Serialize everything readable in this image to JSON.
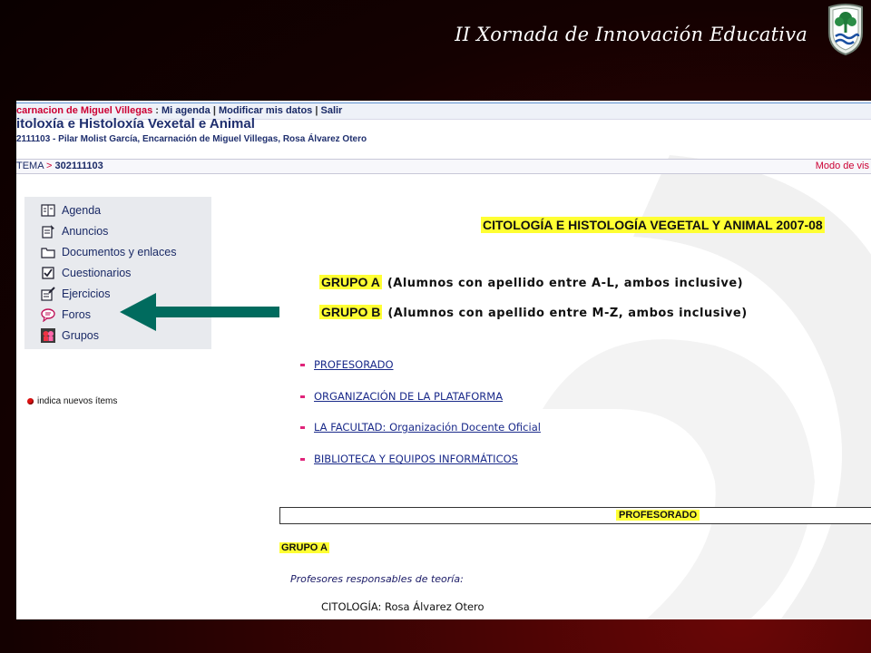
{
  "slide": {
    "title": "II Xornada de Innovación Educativa"
  },
  "topbar": {
    "user_name": "carnacion de Miguel Villegas",
    "links": [
      "Mi agenda",
      "Modificar mis datos",
      "Salir"
    ]
  },
  "course": {
    "title": "itoloxía e Histoloxía Vexetal e Animal",
    "professors": "2111103 - Pilar Molist García, Encarnación de Miguel Villegas, Rosa Álvarez Otero"
  },
  "breadcrumb": {
    "root": "TEMA",
    "separator": ">",
    "code": "302111103",
    "mode": "Modo de vis"
  },
  "sidebar": {
    "items": [
      {
        "label": "Agenda",
        "icon": "agenda-icon"
      },
      {
        "label": "Anuncios",
        "icon": "announcements-icon"
      },
      {
        "label": "Documentos y enlaces",
        "icon": "folder-icon"
      },
      {
        "label": "Cuestionarios",
        "icon": "checkbox-icon"
      },
      {
        "label": "Ejercicios",
        "icon": "exercise-icon"
      },
      {
        "label": "Foros",
        "icon": "forum-icon"
      },
      {
        "label": "Grupos",
        "icon": "groups-icon"
      }
    ],
    "legend": "indica nuevos ítems"
  },
  "content": {
    "heading": "CITOLOGÍA E HISTOLOGÍA VEGETAL Y ANIMAL 2007-08",
    "groups": [
      {
        "tag": "GRUPO A",
        "desc": "(Alumnos con apellido entre A-L, ambos inclusive)"
      },
      {
        "tag": "GRUPO B",
        "desc": "(Alumnos con apellido entre M-Z, ambos inclusive)"
      }
    ],
    "links": [
      "PROFESORADO",
      "ORGANIZACIÓN DE LA PLATAFORMA",
      "LA FACULTAD: Organización Docente Oficial",
      "BIBLIOTECA Y EQUIPOS INFORMÁTICOS"
    ],
    "section_label": "PROFESORADO",
    "section_group": "GRUPO A",
    "responsables": "Profesores responsables de teoría:",
    "citologia": "CITOLOGÍA: Rosa Álvarez Otero"
  },
  "colors": {
    "accent_yellow": "#ffff33",
    "link_blue": "#1a2a8a",
    "arrow_teal": "#006b5e",
    "user_red": "#cc0033"
  }
}
